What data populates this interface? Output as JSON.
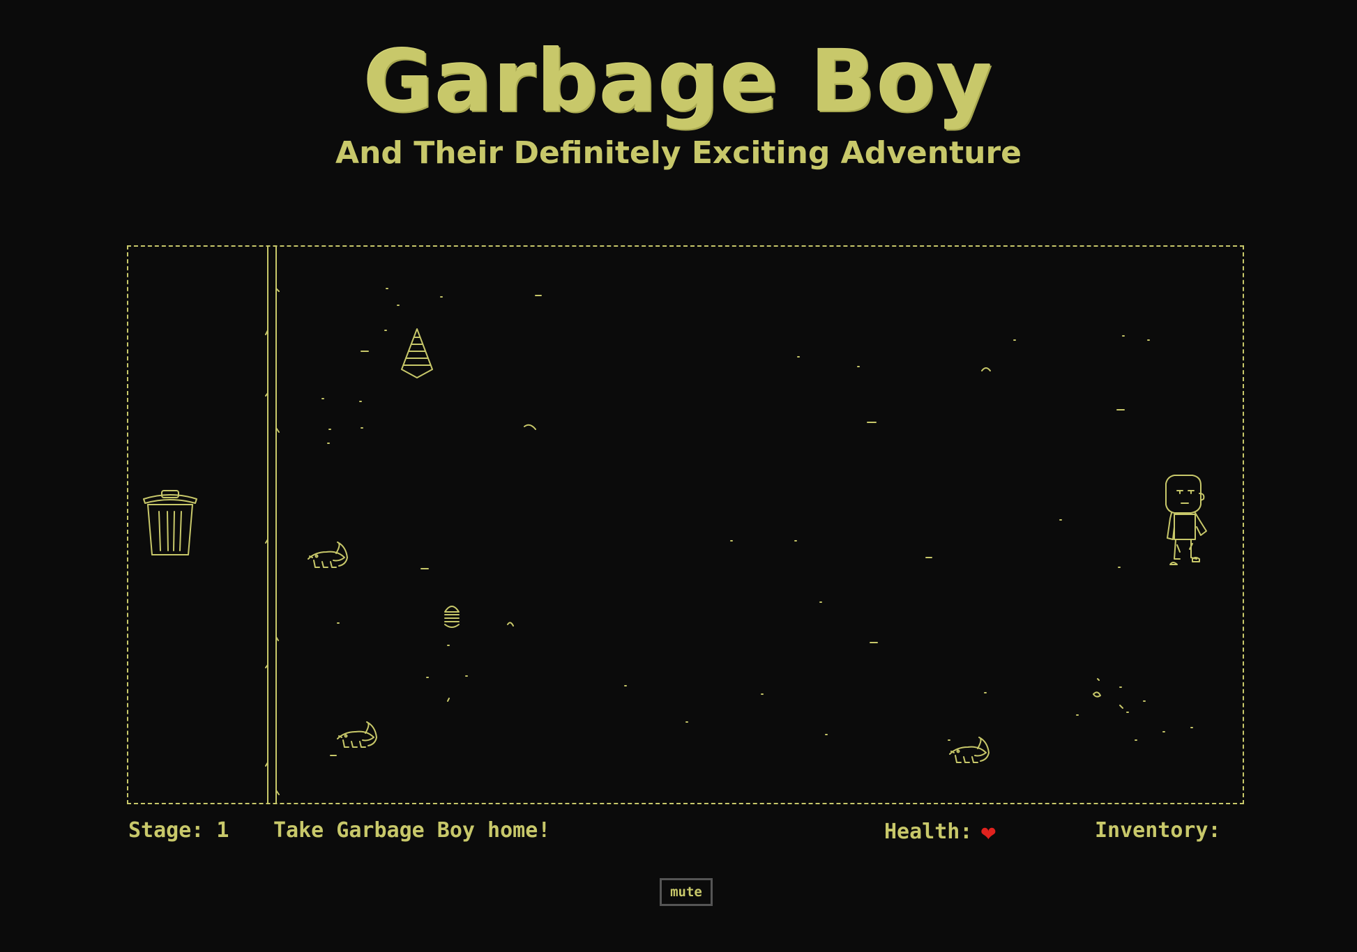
{
  "header": {
    "title": "Garbage Boy",
    "subtitle": "And Their Definitely Exciting Adventure"
  },
  "game": {
    "sprites": [
      "trash-can-icon",
      "traffic-cone-icon",
      "rat-icon",
      "burger-icon",
      "garbage-boy-icon"
    ]
  },
  "hud": {
    "stage_label": "Stage: 1",
    "message": "Take Garbage Boy home!",
    "health_label": "Health:",
    "health_icon": "heart-icon",
    "inventory_label": "Inventory:"
  },
  "controls": {
    "mute_label": "mute"
  },
  "colors": {
    "background": "#0b0b0b",
    "accent": "#c8c86a",
    "heart": "#e0221e"
  }
}
